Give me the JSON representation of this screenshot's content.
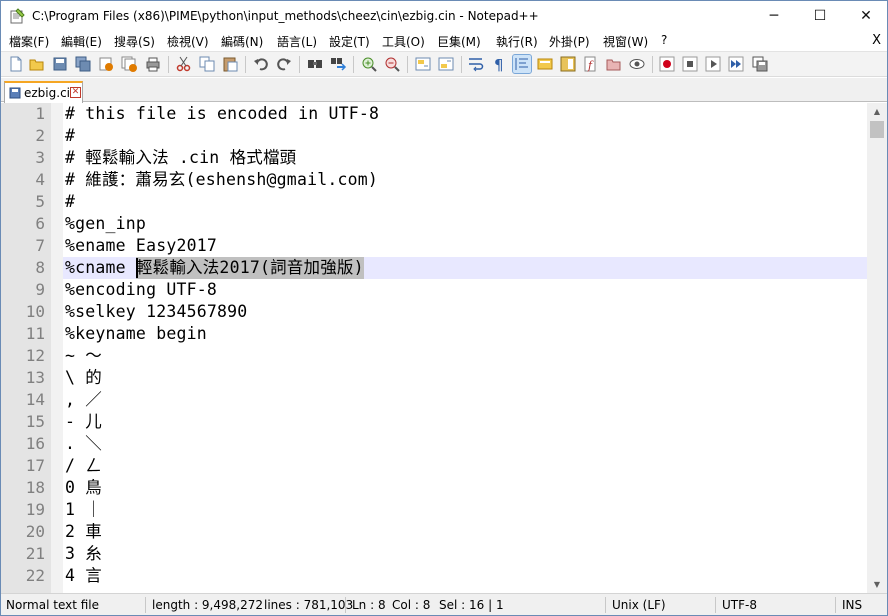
{
  "window": {
    "title": "C:\\Program Files (x86)\\PIME\\python\\input_methods\\cheez\\cin\\ezbig.cin - Notepad++",
    "minimize_glyph": "─",
    "maximize_glyph": "☐",
    "close_glyph": "✕"
  },
  "menu": {
    "items": [
      "檔案(F)",
      "編輯(E)",
      "搜尋(S)",
      "檢視(V)",
      "編碼(N)",
      "語言(L)",
      "設定(T)",
      "工具(O)",
      "巨集(M)",
      "執行(R)",
      "外掛(P)",
      "視窗(W)",
      "?"
    ],
    "close_document": "X"
  },
  "toolbar": {
    "icons": [
      "new-file-icon",
      "open-file-icon",
      "save-icon",
      "save-all-icon",
      "close-icon",
      "close-all-icon",
      "print-icon",
      "cut-icon",
      "copy-icon",
      "paste-icon",
      "undo-icon",
      "redo-icon",
      "find-icon",
      "replace-icon",
      "zoom-in-icon",
      "zoom-out-icon",
      "sync-vertical-icon",
      "sync-horizontal-icon",
      "word-wrap-icon",
      "show-all-chars-icon",
      "indent-guide-icon",
      "user-language-icon",
      "doc-map-icon",
      "function-list-icon",
      "folder-workspace-icon",
      "monitoring-icon",
      "record-macro-icon",
      "stop-macro-icon",
      "play-macro-icon",
      "run-macro-multiple-icon",
      "save-macro-icon"
    ]
  },
  "tab": {
    "label": "ezbig.cin",
    "close_glyph": "✕"
  },
  "editor": {
    "lines": [
      {
        "num": "1",
        "text": "# this file is encoded in UTF-8"
      },
      {
        "num": "2",
        "text": "#"
      },
      {
        "num": "3",
        "text": "# 輕鬆輸入法 .cin 格式檔頭"
      },
      {
        "num": "4",
        "text": "# 維護：蕭易玄(eshensh@gmail.com)"
      },
      {
        "num": "5",
        "text": "#"
      },
      {
        "num": "6",
        "text": "%gen_inp"
      },
      {
        "num": "7",
        "text": "%ename Easy2017"
      },
      {
        "num": "8",
        "text": "%cname 輕鬆輸入法2017(詞音加強版)"
      },
      {
        "num": "9",
        "text": "%encoding UTF-8"
      },
      {
        "num": "10",
        "text": "%selkey 1234567890"
      },
      {
        "num": "11",
        "text": "%keyname begin"
      },
      {
        "num": "12",
        "text": "~ ～"
      },
      {
        "num": "13",
        "text": "\\ 的"
      },
      {
        "num": "14",
        "text": ", ／"
      },
      {
        "num": "15",
        "text": "- 儿"
      },
      {
        "num": "16",
        "text": ". ＼"
      },
      {
        "num": "17",
        "text": "/ ㄥ"
      },
      {
        "num": "18",
        "text": "0 鳥"
      },
      {
        "num": "19",
        "text": "1 ｜"
      },
      {
        "num": "20",
        "text": "2 車"
      },
      {
        "num": "21",
        "text": "3 糸"
      },
      {
        "num": "22",
        "text": "4 言"
      }
    ],
    "current_line": 8
  },
  "status": {
    "doc_type": "Normal text file",
    "length": "length : 9,498,272",
    "lines": "lines : 781,103",
    "ln": "Ln : 8",
    "col": "Col : 8",
    "sel": "Sel : 16 | 1",
    "eol": "Unix (LF)",
    "encoding": "UTF-8",
    "mode": "INS"
  },
  "colors": {
    "gutter_bg": "#e4e4e4",
    "current_line_bg": "#e8e8ff",
    "selection_bg": "#c0c0c0",
    "tab_accent": "#f5a623"
  }
}
